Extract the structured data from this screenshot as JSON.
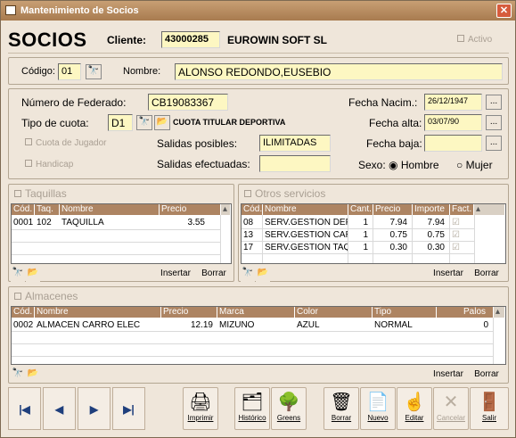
{
  "window": {
    "title": "Mantenimiento de Socios"
  },
  "header": {
    "title": "SOCIOS",
    "cliente_label": "Cliente:",
    "cliente_code": "43000285",
    "cliente_name": "EUROWIN SOFT SL",
    "activo_label": "Activo"
  },
  "codigo": {
    "label": "Código:",
    "value": "01",
    "nombre_label": "Nombre:",
    "nombre_value": "ALONSO REDONDO,EUSEBIO"
  },
  "federado": {
    "label": "Número de Federado:",
    "value": "CB19083367"
  },
  "cuota": {
    "label": "Tipo de cuota:",
    "value": "D1",
    "desc": "CUOTA TITULAR DEPORTIVA"
  },
  "jugador": {
    "cuota_label": "Cuota de Jugador",
    "handicap_label": "Handicap"
  },
  "salidas": {
    "posibles_label": "Salidas posibles:",
    "posibles_value": "ILIMITADAS",
    "efectuadas_label": "Salidas efectuadas:",
    "efectuadas_value": ""
  },
  "fechas": {
    "nacim_label": "Fecha Nacim.:",
    "nacim_value": "26/12/1947",
    "alta_label": "Fecha alta:",
    "alta_value": "03/07/90",
    "baja_label": "Fecha baja:",
    "baja_value": ""
  },
  "sexo": {
    "label": "Sexo:",
    "hombre": "Hombre",
    "mujer": "Mujer",
    "selected": "Hombre"
  },
  "taquillas": {
    "title": "Taquillas",
    "headers": [
      "Cód.",
      "Taq.",
      "Nombre",
      "Precio"
    ],
    "rows": [
      [
        "0001",
        "102",
        "TAQUILLA",
        "3.55"
      ]
    ],
    "insert": "Insertar",
    "delete": "Borrar"
  },
  "otros": {
    "title": "Otros servicios",
    "headers": [
      "Cód.",
      "Nombre",
      "Cant.",
      "Precio",
      "Importe",
      "Fact."
    ],
    "rows": [
      [
        "08",
        "SERV.GESTION DEPC",
        "1",
        "7.94",
        "7.94"
      ],
      [
        "13",
        "SERV.GESTION CARF",
        "1",
        "0.75",
        "0.75"
      ],
      [
        "17",
        "SERV.GESTION TAQU",
        "1",
        "0.30",
        "0.30"
      ]
    ],
    "insert": "Insertar",
    "delete": "Borrar"
  },
  "almacenes": {
    "title": "Almacenes",
    "headers": [
      "Cód.",
      "Nombre",
      "Precio",
      "Marca",
      "Color",
      "Tipo",
      "Palos"
    ],
    "rows": [
      [
        "0002",
        "ALMACEN CARRO ELEC",
        "12.19",
        "MIZUNO",
        "AZUL",
        "NORMAL",
        "0"
      ]
    ],
    "insert": "Insertar",
    "delete": "Borrar"
  },
  "toolbar": {
    "first": "|◀",
    "prev": "◀",
    "next": "▶",
    "last": "▶|",
    "imprimir": "Imprimir",
    "historico": "Histórico",
    "greens": "Greens",
    "borrar": "Borrar",
    "nuevo": "Nuevo",
    "editar": "Editar",
    "cancelar": "Cancelar",
    "salir": "Salir"
  }
}
